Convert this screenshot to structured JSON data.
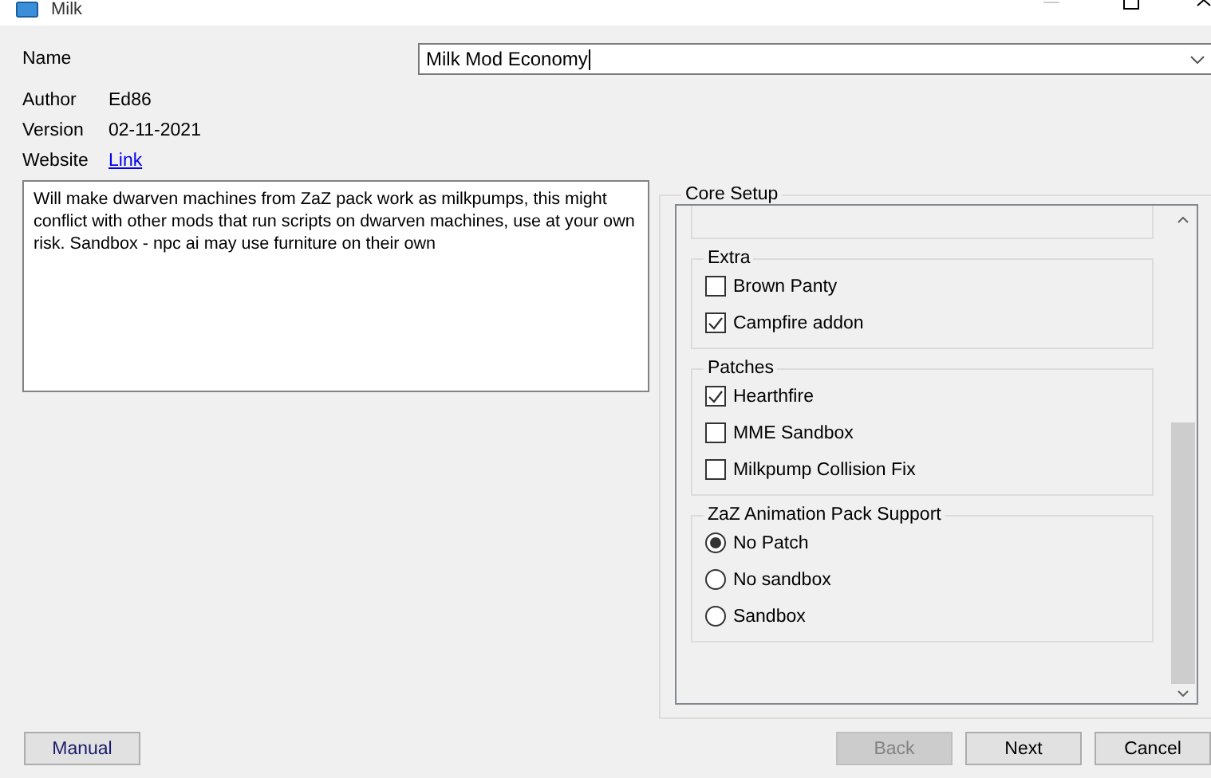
{
  "window": {
    "title": "Milk"
  },
  "name": {
    "label": "Name",
    "value": "Milk Mod Economy"
  },
  "info": [
    {
      "label": "Author",
      "value": "Ed86",
      "kind": "text"
    },
    {
      "label": "Version",
      "value": "02-11-2021",
      "kind": "text"
    },
    {
      "label": "Website",
      "value": "Link",
      "kind": "link"
    }
  ],
  "description": "Will make dwarven machines from ZaZ pack work as milkpumps, this might conflict with other mods that run scripts on dwarven machines, use at your own risk. Sandbox - npc ai may use furniture on their own",
  "core_setup": {
    "title": "Core Setup",
    "groups": [
      {
        "kind": "cut"
      },
      {
        "kind": "full",
        "title": "Extra",
        "options": [
          {
            "kind": "checkbox",
            "label": "Brown Panty",
            "checked": false
          },
          {
            "kind": "checkbox",
            "label": "Campfire addon",
            "checked": true
          }
        ]
      },
      {
        "kind": "full",
        "title": "Patches",
        "options": [
          {
            "kind": "checkbox",
            "label": "Hearthfire",
            "checked": true
          },
          {
            "kind": "checkbox",
            "label": "MME Sandbox",
            "checked": false
          },
          {
            "kind": "checkbox",
            "label": "Milkpump Collision Fix",
            "checked": false
          }
        ]
      },
      {
        "kind": "full",
        "title": "ZaZ Animation Pack Support",
        "options": [
          {
            "kind": "radio",
            "label": "No Patch",
            "selected": true
          },
          {
            "kind": "radio",
            "label": "No sandbox",
            "selected": false
          },
          {
            "kind": "radio",
            "label": "Sandbox",
            "selected": false
          }
        ]
      }
    ]
  },
  "buttons_left": [
    {
      "label": "Manual",
      "disabled": false
    }
  ],
  "buttons_right": [
    {
      "label": "Back",
      "disabled": true
    },
    {
      "label": "Next",
      "disabled": false
    },
    {
      "label": "Cancel",
      "disabled": false
    }
  ]
}
